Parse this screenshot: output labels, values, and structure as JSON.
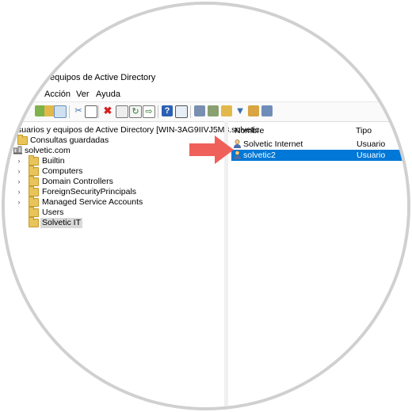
{
  "window": {
    "title": "equipos de Active Directory"
  },
  "menu": [
    "Acción",
    "Ver",
    "Ayuda"
  ],
  "tree": {
    "root": "suarios y equipos de Active Directory [WIN-3AG9IIVJ5M3.solvetic.",
    "saved_queries": "Consultas guardadas",
    "domain": "solvetic.com",
    "items": [
      {
        "label": "Builtin"
      },
      {
        "label": "Computers"
      },
      {
        "label": "Domain Controllers"
      },
      {
        "label": "ForeignSecurityPrincipals"
      },
      {
        "label": "Managed Service Accounts"
      },
      {
        "label": "Users"
      },
      {
        "label": "Solvetic IT"
      }
    ]
  },
  "list": {
    "columns": {
      "name": "Nombre",
      "type": "Tipo"
    },
    "rows": [
      {
        "name": "Solvetic Internet",
        "type": "Usuario"
      },
      {
        "name": "solvetic2",
        "type": "Usuario"
      }
    ]
  },
  "colors": {
    "selection": "#0078d7",
    "arrow": "#f0605a",
    "folder": "#e8c45a"
  },
  "icons": [
    "back-icon",
    "folder-up-icon",
    "console-tree-icon",
    "cut-icon",
    "copy-icon",
    "delete-icon",
    "properties-icon",
    "refresh-icon",
    "export-icon",
    "help-icon",
    "view-icon",
    "new-user-icon",
    "new-group-icon",
    "new-ou-icon",
    "filter-icon",
    "add-to-group-icon",
    "delegate-icon"
  ]
}
